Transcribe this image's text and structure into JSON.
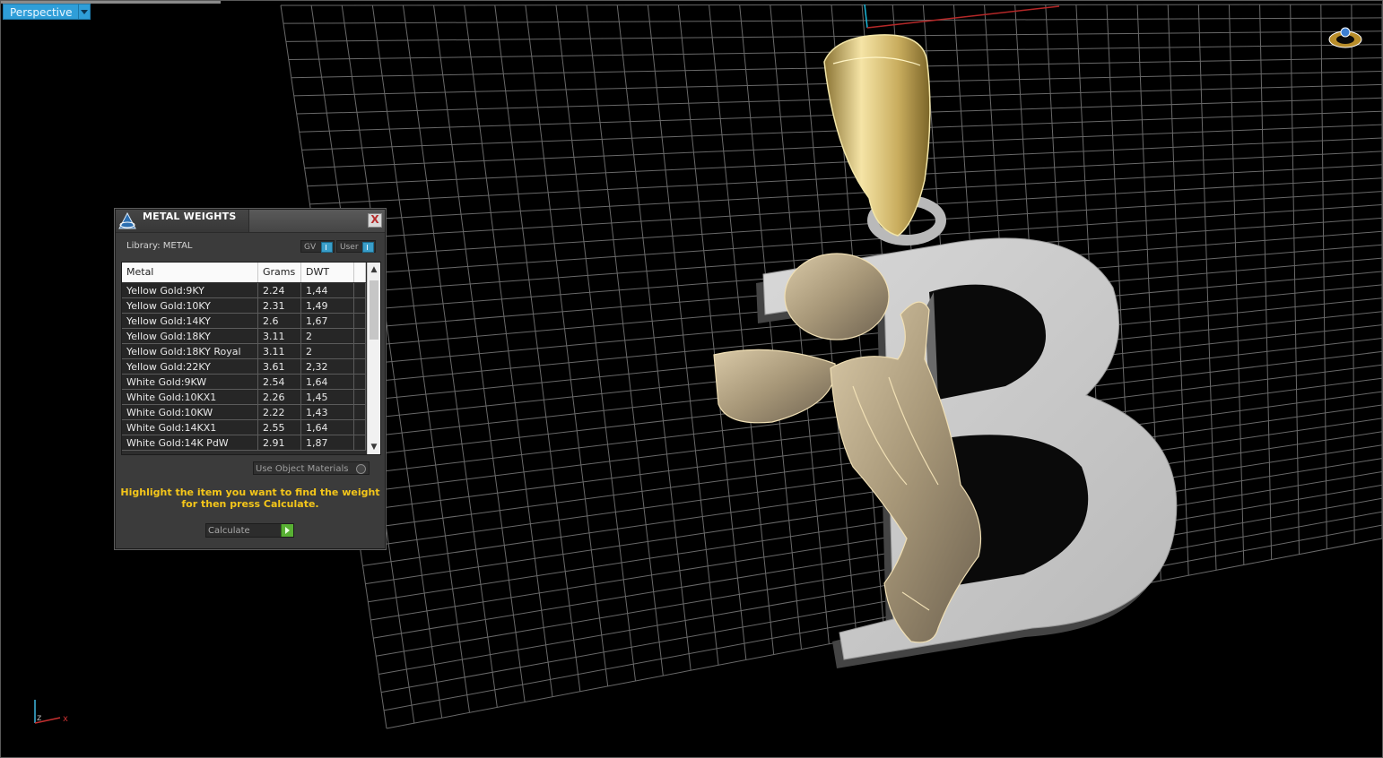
{
  "viewport": {
    "label": "Perspective",
    "axes": {
      "x": "x",
      "z": "z"
    }
  },
  "panel": {
    "title": "METAL WEIGHTS",
    "close_label": "X",
    "library_label": "Library: METAL",
    "toggle_gv": "GV",
    "toggle_user": "User",
    "columns": [
      "Metal",
      "Grams",
      "DWT"
    ],
    "rows": [
      {
        "metal": "Yellow Gold:9KY",
        "grams": "2.24",
        "dwt": "1,44"
      },
      {
        "metal": "Yellow Gold:10KY",
        "grams": "2.31",
        "dwt": "1,49"
      },
      {
        "metal": "Yellow Gold:14KY",
        "grams": "2.6",
        "dwt": "1,67"
      },
      {
        "metal": "Yellow Gold:18KY",
        "grams": "3.11",
        "dwt": "2"
      },
      {
        "metal": "Yellow Gold:18KY Royal",
        "grams": "3.11",
        "dwt": "2"
      },
      {
        "metal": "Yellow Gold:22KY",
        "grams": "3.61",
        "dwt": "2,32"
      },
      {
        "metal": "White Gold:9KW",
        "grams": "2.54",
        "dwt": "1,64"
      },
      {
        "metal": "White Gold:10KX1",
        "grams": "2.26",
        "dwt": "1,45"
      },
      {
        "metal": "White Gold:10KW",
        "grams": "2.22",
        "dwt": "1,43"
      },
      {
        "metal": "White Gold:14KX1",
        "grams": "2.55",
        "dwt": "1,64"
      },
      {
        "metal": "White Gold:14K PdW",
        "grams": "2.91",
        "dwt": "1,87"
      }
    ],
    "use_object_materials": "Use Object Materials",
    "hint": "Highlight the item you want to find the weight for then press Calculate.",
    "calculate_label": "Calculate"
  },
  "colors": {
    "accent": "#2f9ed8",
    "hint_text": "#f4c61a",
    "go_button": "#58b033",
    "gold": "#e2cc84",
    "silver": "#c7c7c7"
  }
}
